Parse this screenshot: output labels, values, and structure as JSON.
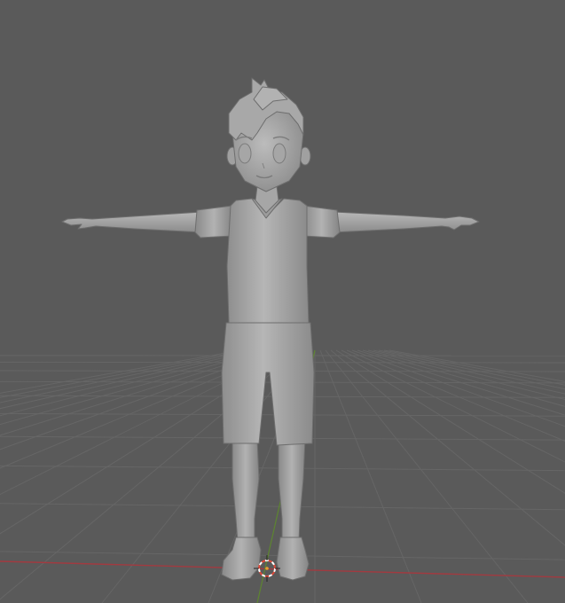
{
  "viewport": {
    "background_color": "#5a5a5a",
    "grid_color": "#6a6a6a",
    "x_axis_color": "#a23a40",
    "y_axis_color": "#5e8a2c",
    "character_light": "#b4b4b4",
    "character_mid": "#9a9a9a",
    "character_shadow": "#6f6f6f",
    "cursor_ring_primary": "#e24a3a",
    "cursor_ring_secondary": "#ffffff",
    "cursor_icon": "3d-cursor-icon",
    "object": "tpose-character-mesh"
  }
}
